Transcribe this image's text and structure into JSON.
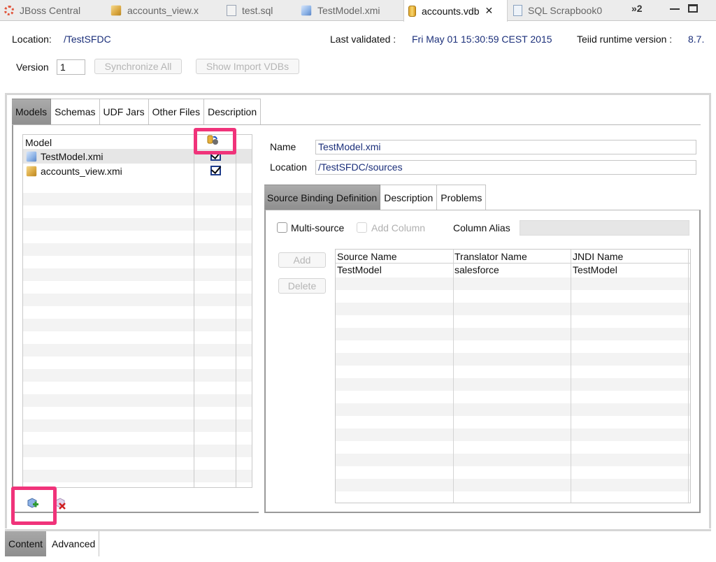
{
  "editor_tabs": [
    {
      "label": "JBoss Central",
      "icon": "spinner-icon"
    },
    {
      "label": "accounts_view.x",
      "icon": "view-model-icon"
    },
    {
      "label": "test.sql",
      "icon": "sql-file-icon"
    },
    {
      "label": "TestModel.xmi",
      "icon": "source-model-icon"
    },
    {
      "label": "accounts.vdb",
      "icon": "vdb-icon",
      "active": true
    },
    {
      "label": "SQL Scrapbook0",
      "icon": "scrapbook-icon"
    }
  ],
  "overflow_label": "»2",
  "header": {
    "location_label": "Location:",
    "location_value": "/TestSFDC",
    "last_validated_label": "Last validated :",
    "last_validated_value": "Fri May 01 15:30:59 CEST 2015",
    "runtime_label": "Teiid runtime version :",
    "runtime_value": "8.7.",
    "version_label": "Version",
    "version_value": "1",
    "sync_all_label": "Synchronize All",
    "show_import_label": "Show Import VDBs"
  },
  "main_tabs": [
    "Models",
    "Schemas",
    "UDF Jars",
    "Other Files",
    "Description"
  ],
  "model_table": {
    "column_header": "Model",
    "rows": [
      {
        "name": "TestModel.xmi",
        "icon": "source-model-icon",
        "checked": true
      },
      {
        "name": "accounts_view.xmi",
        "icon": "view-model-icon",
        "checked": true
      }
    ]
  },
  "details": {
    "name_label": "Name",
    "name_value": "TestModel.xmi",
    "location_label": "Location",
    "location_value": "/TestSFDC/sources"
  },
  "detail_tabs": [
    "Source Binding Definition",
    "Description",
    "Problems"
  ],
  "binding": {
    "multi_source_label": "Multi-source",
    "add_column_label": "Add Column",
    "column_alias_label": "Column Alias",
    "add_label": "Add",
    "delete_label": "Delete",
    "columns": [
      "Source Name",
      "Translator Name",
      "JNDI Name"
    ],
    "rows": [
      {
        "source": "TestModel",
        "translator": "salesforce",
        "jndi": "TestModel"
      }
    ]
  },
  "bottom_tabs": [
    "Content",
    "Advanced"
  ],
  "colors": {
    "highlight": "#f0337a",
    "value_text": "#1b2f7a"
  }
}
